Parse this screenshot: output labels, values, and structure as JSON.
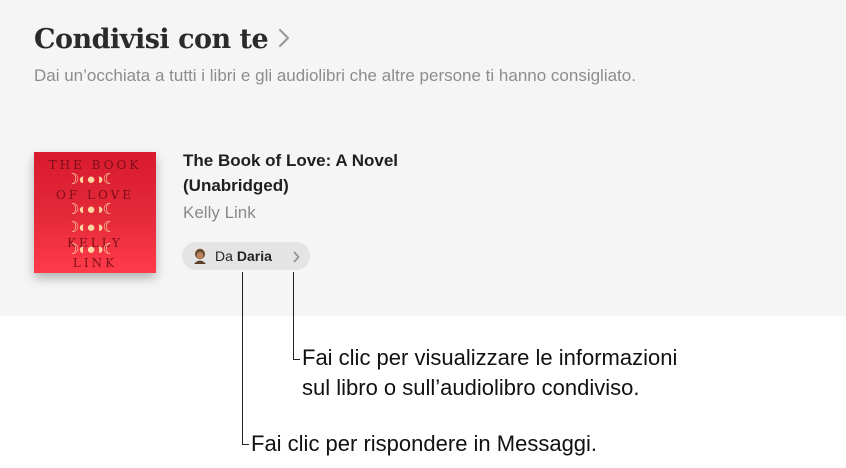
{
  "section": {
    "title": "Condivisi con te",
    "subtitle": "Dai un’occhiata a tutti i libri e gli audiolibri che altre persone ti hanno consigliato."
  },
  "book": {
    "title": "The Book of Love: A Novel (Unabridged)",
    "author": "Kelly Link",
    "cover_text": {
      "line1": "THE BOOK",
      "line2": "OF LOVE",
      "line3": "KELLY",
      "line4": "LINK"
    },
    "cover_color": "#e5202f"
  },
  "shared": {
    "from_label": "Da",
    "from_name": "Daria"
  },
  "callouts": {
    "info": "Fai clic per visualizzare le informazioni sul libro o sull’audiolibro condiviso.",
    "info_line1": "Fai clic per visualizzare le informazioni",
    "info_line2": "sul libro o sull’audiolibro condiviso.",
    "reply": "Fai clic per rispondere in Messaggi."
  },
  "icons": {
    "header_chevron": "chevron-right-icon",
    "pill_chevron": "chevron-right-icon",
    "avatar": "memoji-avatar-icon"
  }
}
